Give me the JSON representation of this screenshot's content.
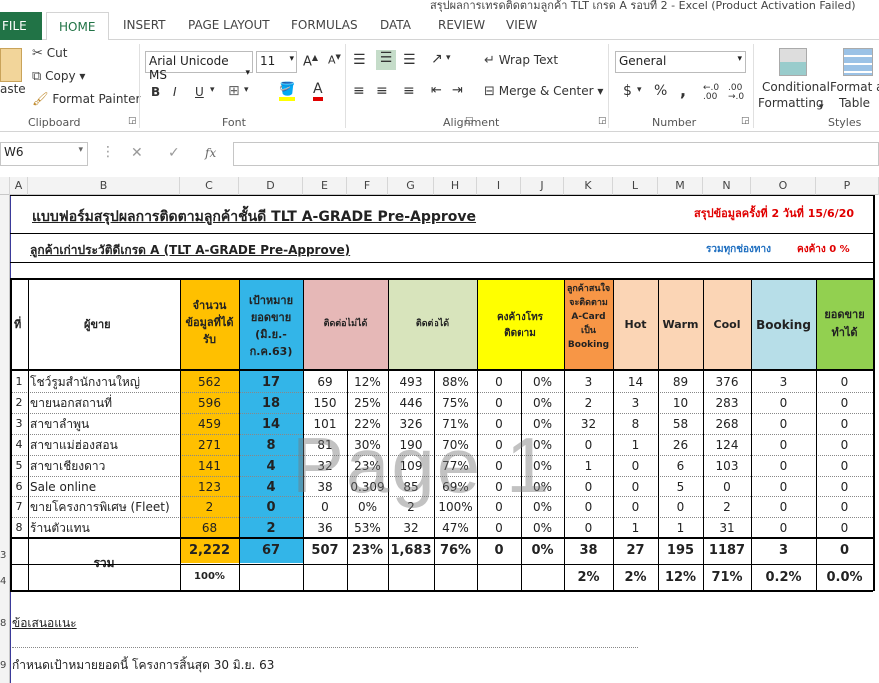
{
  "window": {
    "title": "สรุปผลการเทรดติดตามลูกค้า TLT เกรด A รอบที่ 2 - Excel (Product Activation Failed)"
  },
  "ribbon": {
    "tabs": [
      "FILE",
      "HOME",
      "INSERT",
      "PAGE LAYOUT",
      "FORMULAS",
      "DATA",
      "REVIEW",
      "VIEW"
    ],
    "clipboard": {
      "paste": "aste",
      "cut": "Cut",
      "copy": "Copy",
      "format_painter": "Format Painter",
      "label": "Clipboard"
    },
    "font": {
      "name": "Arial Unicode MS",
      "size": "11",
      "bold": "B",
      "italic": "I",
      "underline": "U",
      "label": "Font"
    },
    "alignment": {
      "wrap": "Wrap Text",
      "merge": "Merge & Center",
      "label": "Alignment"
    },
    "number": {
      "format": "General",
      "currency": "$",
      "percent": "%",
      "comma": ",",
      "label": "Number"
    },
    "styles": {
      "conditional": "Conditional",
      "conditional2": "Formatting",
      "format_as": "Format as",
      "format_as2": "Table",
      "label": "Styles"
    }
  },
  "formula_bar": {
    "name_box": "W6",
    "fx": "fx",
    "content": ""
  },
  "columns": [
    "A",
    "B",
    "C",
    "D",
    "E",
    "F",
    "G",
    "H",
    "I",
    "J",
    "K",
    "L",
    "M",
    "N",
    "O",
    "P"
  ],
  "sheet": {
    "title": "แบบฟอร์มสรุปผลการติดตามลูกค้าชั้นดี TLT A-GRADE Pre-Approve",
    "summary_round": "สรุปข้อมูลครั้งที่ 2  วันที่ 15/6/20",
    "subtitle": "ลูกค้าเก่าประวัติดีเกรด A  (TLT A-GRADE Pre-Approve)",
    "all_channels": "รวมทุกช่องทาง",
    "pending": "คงค้าง 0 %",
    "headers": {
      "no": "ที่",
      "seller": "ผู้ขาย",
      "data_count": "จำนวนข้อมูลที่ได้รับ",
      "target": "เป้าหมายยอดขาย (มิ.ย.-ก.ค.63)",
      "no_contact": "ติดต่อไม่ได้",
      "contacted": "ติดต่อได้",
      "pending_follow": "คงค้างโทรติดตาม",
      "acard": "ลูกค้าสนใจจะติดตาม A-Card เป็น Booking",
      "hot": "Hot",
      "warm": "Warm",
      "cool": "Cool",
      "booking": "Booking",
      "sales": "ยอดขายทำได้"
    },
    "rows": [
      {
        "no": "1",
        "name": "โชว์รูมสำนักงานใหญ่",
        "c": "562",
        "d": "17",
        "e": "69",
        "f": "12%",
        "g": "493",
        "h": "88%",
        "i": "0",
        "j": "0%",
        "k": "3",
        "l": "14",
        "m": "89",
        "n": "376",
        "o": "3",
        "p": "0"
      },
      {
        "no": "2",
        "name": "ขายนอกสถานที่",
        "c": "596",
        "d": "18",
        "e": "150",
        "f": "25%",
        "g": "446",
        "h": "75%",
        "i": "0",
        "j": "0%",
        "k": "2",
        "l": "3",
        "m": "10",
        "n": "283",
        "o": "0",
        "p": "0"
      },
      {
        "no": "3",
        "name": "สาขาลำพูน",
        "c": "459",
        "d": "14",
        "e": "101",
        "f": "22%",
        "g": "326",
        "h": "71%",
        "i": "0",
        "j": "0%",
        "k": "32",
        "l": "8",
        "m": "58",
        "n": "268",
        "o": "0",
        "p": "0"
      },
      {
        "no": "4",
        "name": "สาขาแม่ฮ่องสอน",
        "c": "271",
        "d": "8",
        "e": "81",
        "f": "30%",
        "g": "190",
        "h": "70%",
        "i": "0",
        "j": "0%",
        "k": "0",
        "l": "1",
        "m": "26",
        "n": "124",
        "o": "0",
        "p": "0"
      },
      {
        "no": "5",
        "name": "สาขาเชียงดาว",
        "c": "141",
        "d": "4",
        "e": "32",
        "f": "23%",
        "g": "109",
        "h": "77%",
        "i": "0",
        "j": "0%",
        "k": "1",
        "l": "0",
        "m": "6",
        "n": "103",
        "o": "0",
        "p": "0"
      },
      {
        "no": "6",
        "name": "Sale online",
        "c": "123",
        "d": "4",
        "e": "38",
        "f": "0.309",
        "g": "85",
        "h": "69%",
        "i": "0",
        "j": "0%",
        "k": "0",
        "l": "0",
        "m": "5",
        "n": "0",
        "o": "0",
        "p": "0"
      },
      {
        "no": "7",
        "name": "ขายโครงการพิเศษ (Fleet)",
        "c": "2",
        "d": "0",
        "e": "0",
        "f": "0%",
        "g": "2",
        "h": "100%",
        "i": "0",
        "j": "0%",
        "k": "0",
        "l": "0",
        "m": "0",
        "n": "2",
        "o": "0",
        "p": "0"
      },
      {
        "no": "8",
        "name": "ร้านตัวแทน",
        "c": "68",
        "d": "2",
        "e": "36",
        "f": "53%",
        "g": "32",
        "h": "47%",
        "i": "0",
        "j": "0%",
        "k": "0",
        "l": "1",
        "m": "1",
        "n": "31",
        "o": "0",
        "p": "0"
      }
    ],
    "total": {
      "label": "รวม",
      "c": "2,222",
      "d": "67",
      "e": "507",
      "f": "23%",
      "g": "1,683",
      "h": "76%",
      "i": "0",
      "j": "0%",
      "k": "38",
      "l": "27",
      "m": "195",
      "n": "1187",
      "o": "3",
      "p": "0"
    },
    "pct": {
      "c": "100%",
      "k": "2%",
      "l": "2%",
      "m": "12%",
      "n": "71%",
      "o": "0.2%",
      "p": "0.0%"
    },
    "suggest": "ข้อเสนอแนะ",
    "footer": "กำหนดเป้าหมายยอดนี้ โครงการสิ้นสุด 30 มิ.ย. 63",
    "row_numbers": [
      "3",
      "4",
      "8",
      "9"
    ]
  },
  "watermark": "Page 1",
  "colors": {
    "excel_green": "#217346",
    "yellow": "#ffc000",
    "blue": "#33b5e8",
    "pink": "#e6b8b7",
    "lightgreen": "#d8e4bc",
    "brightyellow": "#ffff00",
    "orange": "#f79646",
    "peach": "#fbd5b5",
    "lightblue": "#b7dee8",
    "green": "#92d050"
  }
}
